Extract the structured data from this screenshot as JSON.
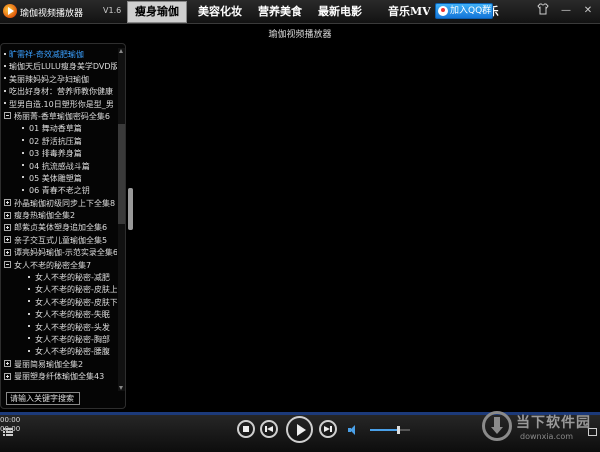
{
  "app": {
    "title": "瑜伽视频播放器",
    "version": "V1.6"
  },
  "nav": {
    "tabs": [
      {
        "label": "瘦身瑜伽",
        "active": true
      },
      {
        "label": "美容化妆",
        "active": false
      },
      {
        "label": "营养美食",
        "active": false
      },
      {
        "label": "最新电影",
        "active": false
      },
      {
        "label": "音乐MV",
        "active": false
      },
      {
        "label": "综艺娱乐",
        "active": false
      }
    ]
  },
  "qq_button": {
    "label": "加入QQ群"
  },
  "window_controls": {
    "skin": "shirt-icon",
    "minimize": "—",
    "close": "✕"
  },
  "video": {
    "title": "瑜伽视频播放器"
  },
  "playlist": {
    "items": [
      {
        "text": "旷需祥-奇效减肥瑜伽",
        "kind": "bullet",
        "highlight": true
      },
      {
        "text": "瑜伽天后LULU瘦身美学DVD版",
        "kind": "bullet"
      },
      {
        "text": "美丽辣妈妈之孕妇瑜伽",
        "kind": "bullet"
      },
      {
        "text": "吃出好身材：营养师教你健康",
        "kind": "bullet"
      },
      {
        "text": "型男自造.10日塑形你是型_男",
        "kind": "bullet"
      },
      {
        "text": "杨丽菁-香草瑜伽密码全集6",
        "kind": "expanded"
      },
      {
        "text": "01 舞动香草篇",
        "kind": "episode"
      },
      {
        "text": "02 舒活抗压篇",
        "kind": "episode"
      },
      {
        "text": "03 排毒养身篇",
        "kind": "episode"
      },
      {
        "text": "04 抗流感战斗篇",
        "kind": "episode"
      },
      {
        "text": "05 美体雕塑篇",
        "kind": "episode"
      },
      {
        "text": "06 青春不老之钥",
        "kind": "episode"
      },
      {
        "text": "孙晶瑜伽初级同步上下全集8",
        "kind": "collapsed"
      },
      {
        "text": "瘦身热瑜伽全集2",
        "kind": "collapsed"
      },
      {
        "text": "郎紫贞美体塑身追加全集6",
        "kind": "collapsed"
      },
      {
        "text": "亲子交互式儿童瑜伽全集5",
        "kind": "collapsed"
      },
      {
        "text": "谭亮妈妈瑜伽-示范实录全集6",
        "kind": "collapsed"
      },
      {
        "text": "女人不老的秘密全集7",
        "kind": "expanded"
      },
      {
        "text": "女人不老的秘密-减肥",
        "kind": "episode-deep"
      },
      {
        "text": "女人不老的秘密-皮肤上",
        "kind": "episode-deep"
      },
      {
        "text": "女人不老的秘密-皮肤下",
        "kind": "episode-deep"
      },
      {
        "text": "女人不老的秘密-失眠",
        "kind": "episode-deep"
      },
      {
        "text": "女人不老的秘密-头发",
        "kind": "episode-deep"
      },
      {
        "text": "女人不老的秘密-胸部",
        "kind": "episode-deep"
      },
      {
        "text": "女人不老的秘密-腰腹",
        "kind": "episode-deep"
      },
      {
        "text": "曼丽简易瑜伽全集2",
        "kind": "collapsed"
      },
      {
        "text": "曼丽塑身纤体瑜伽全集43",
        "kind": "collapsed"
      }
    ],
    "search_placeholder": "请输入关键字搜索",
    "scroll_fraction": 0.3
  },
  "player": {
    "time_elapsed": "00:00",
    "time_total": "00:00",
    "volume": 0.7,
    "progress": 0
  },
  "watermark": {
    "name": "当下软件园",
    "url": "downxia.com"
  },
  "colors": {
    "accent": "#3aa0ff",
    "nav_active_bg": "#cfcfcf",
    "progress": "#1c3a7a"
  }
}
